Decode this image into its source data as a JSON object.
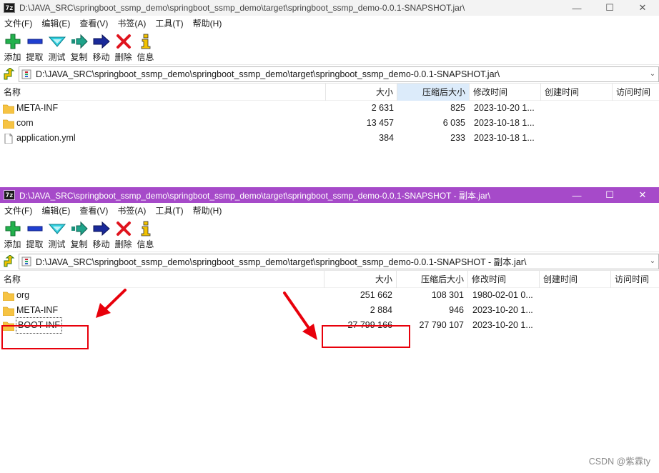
{
  "windows": [
    {
      "id": "w1",
      "title": "D:\\JAVA_SRC\\springboot_ssmp_demo\\springboot_ssmp_demo\\target\\springboot_ssmp_demo-0.0.1-SNAPSHOT.jar\\",
      "address": "D:\\JAVA_SRC\\springboot_ssmp_demo\\springboot_ssmp_demo\\target\\springboot_ssmp_demo-0.0.1-SNAPSHOT.jar\\",
      "rows": [
        {
          "name": "META-INF",
          "type": "folder",
          "size": "2 631",
          "packed": "825",
          "modified": "2023-10-20 1..."
        },
        {
          "name": "com",
          "type": "folder",
          "size": "13 457",
          "packed": "6 035",
          "modified": "2023-10-18 1..."
        },
        {
          "name": "application.yml",
          "type": "file",
          "size": "384",
          "packed": "233",
          "modified": "2023-10-18 1..."
        }
      ]
    },
    {
      "id": "w2",
      "title": "D:\\JAVA_SRC\\springboot_ssmp_demo\\springboot_ssmp_demo\\target\\springboot_ssmp_demo-0.0.1-SNAPSHOT - 副本.jar\\",
      "address": "D:\\JAVA_SRC\\springboot_ssmp_demo\\springboot_ssmp_demo\\target\\springboot_ssmp_demo-0.0.1-SNAPSHOT - 副本.jar\\",
      "rows": [
        {
          "name": "org",
          "type": "folder",
          "size": "251 662",
          "packed": "108 301",
          "modified": "1980-02-01 0..."
        },
        {
          "name": "META-INF",
          "type": "folder",
          "size": "2 884",
          "packed": "946",
          "modified": "2023-10-20 1..."
        },
        {
          "name": "BOOT-INF",
          "type": "folder",
          "size": "27 799 166",
          "packed": "27 790 107",
          "modified": "2023-10-20 1..."
        }
      ]
    }
  ],
  "app_icon_label": "7z",
  "menu": [
    "文件(F)",
    "编辑(E)",
    "查看(V)",
    "书签(A)",
    "工具(T)",
    "帮助(H)"
  ],
  "toolbar": [
    {
      "label": "添加",
      "icon": "add-icon"
    },
    {
      "label": "提取",
      "icon": "extract-icon"
    },
    {
      "label": "测试",
      "icon": "test-icon"
    },
    {
      "label": "复制",
      "icon": "copy-icon"
    },
    {
      "label": "移动",
      "icon": "move-icon"
    },
    {
      "label": "删除",
      "icon": "delete-icon"
    },
    {
      "label": "信息",
      "icon": "info-icon"
    }
  ],
  "columns": {
    "name": "名称",
    "size": "大小",
    "packed": "压缩后大小",
    "modified": "修改时间",
    "created": "创建时间",
    "accessed": "访问时间"
  },
  "watermark": "CSDN @紫霖ty",
  "colors": {
    "active_titlebar": "#a64ac9",
    "highlight": "#e8000b",
    "folder": "#f6c343",
    "sorted_column": "#dcebfa"
  }
}
